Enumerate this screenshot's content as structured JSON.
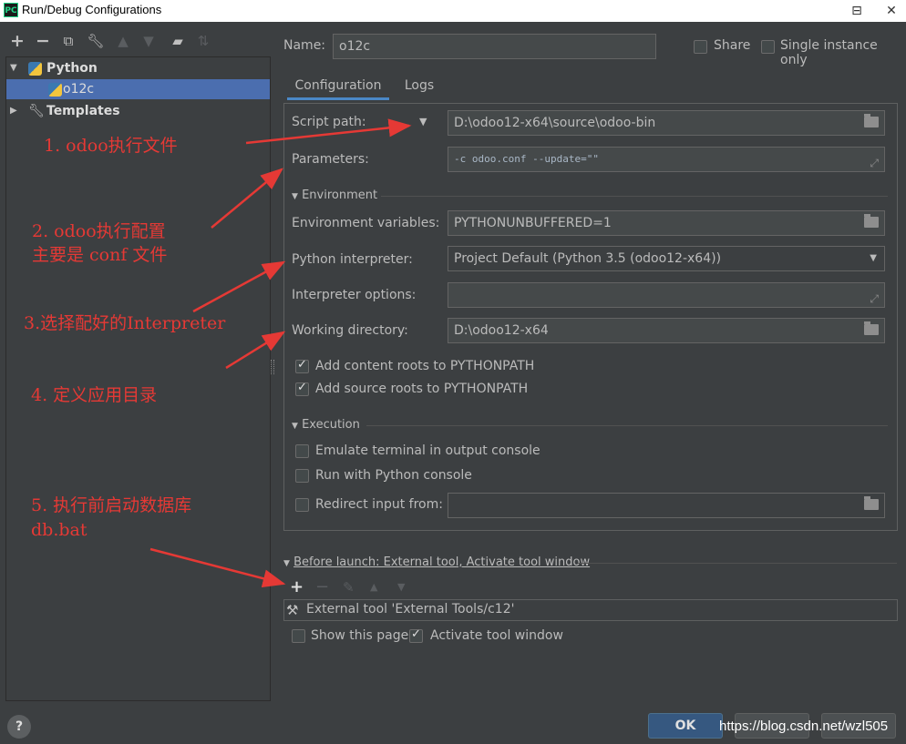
{
  "window": {
    "title": "Run/Debug Configurations",
    "app_icon_text": "PC",
    "minimize_glyph": "⊟",
    "close_glyph": "✕"
  },
  "toolbar": {
    "icons": [
      "add-icon",
      "remove-icon",
      "copy-icon",
      "wrench-icon",
      "move-up-icon",
      "move-down-icon",
      "new-folder-icon",
      "sort-icon"
    ]
  },
  "tree": {
    "items": [
      {
        "label": "Python",
        "icon": "python-icon"
      },
      {
        "label": "o12c",
        "icon": "python-icon"
      },
      {
        "label": "Templates",
        "icon": "wrench-icon"
      }
    ]
  },
  "header": {
    "name_label": "Name:",
    "name_value": "o12c",
    "share_label": "Share",
    "share_checked": false,
    "single_instance_label": "Single instance only",
    "single_instance_checked": false
  },
  "tabs": [
    {
      "label": "Configuration",
      "active": true
    },
    {
      "label": "Logs",
      "active": false
    }
  ],
  "config": {
    "script_path_label": "Script path:",
    "script_path_value": "D:\\odoo12-x64\\source\\odoo-bin",
    "parameters_label": "Parameters:",
    "parameters_value": "-c odoo.conf  --update=\"\"",
    "environment_section": "Environment",
    "env_vars_label": "Environment variables:",
    "env_vars_value": "PYTHONUNBUFFERED=1",
    "interpreter_label": "Python interpreter:",
    "interpreter_value": "Project Default (Python 3.5 (odoo12-x64))",
    "interpreter_options_label": "Interpreter options:",
    "interpreter_options_value": "",
    "working_dir_label": "Working directory:",
    "working_dir_value": "D:\\odoo12-x64",
    "add_content_roots_label": "Add content roots to PYTHONPATH",
    "add_content_roots_checked": true,
    "add_source_roots_label": "Add source roots to PYTHONPATH",
    "add_source_roots_checked": true,
    "execution_section": "Execution",
    "emulate_terminal_label": "Emulate terminal in output console",
    "emulate_terminal_checked": false,
    "run_python_console_label": "Run with Python console",
    "run_python_console_checked": false,
    "redirect_input_label": "Redirect input from:",
    "redirect_input_checked": false,
    "redirect_input_value": ""
  },
  "before_launch": {
    "title": "Before launch: External tool, Activate tool window",
    "tools": [
      "add-icon",
      "remove-icon",
      "edit-icon",
      "move-up-icon",
      "move-down-icon"
    ],
    "items": [
      "External tool 'External Tools/c12'"
    ],
    "show_page_label": "Show this page",
    "show_page_checked": false,
    "activate_tool_window_label": "Activate tool window",
    "activate_tool_window_checked": true
  },
  "footer": {
    "help_label": "?",
    "ok_label": "OK",
    "watermark": "https://blog.csdn.net/wzl505"
  },
  "annotations": {
    "a1": "1. odoo执行文件",
    "a2_line1": "2. odoo执行配置",
    "a2_line2": "主要是 conf 文件",
    "a3": "3.选择配好的Interpreter",
    "a4": "4. 定义应用目录",
    "a5_line1": "5. 执行前启动数据库",
    "a5_line2": "db.bat"
  },
  "colors": {
    "background": "#3c3f41",
    "selection": "#4b6eaf",
    "annotation": "#e53935",
    "ok_button": "#365880"
  }
}
